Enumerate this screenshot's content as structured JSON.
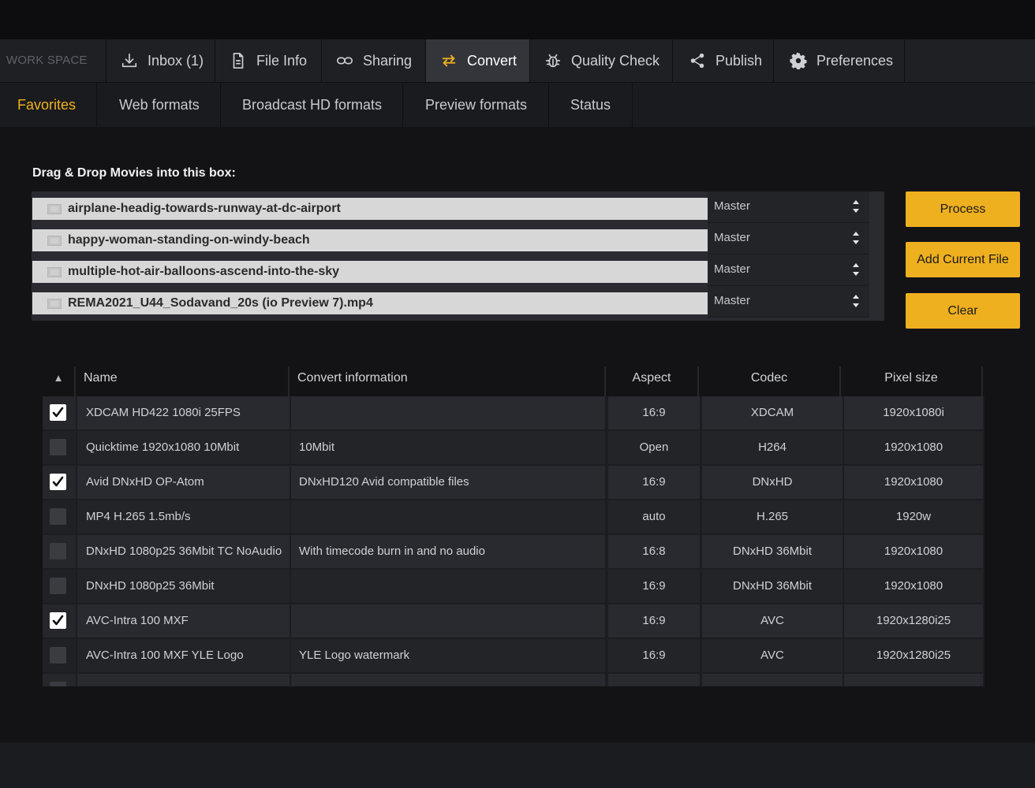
{
  "workspace_label": "WORK SPACE",
  "nav": [
    {
      "label": "Inbox (1)",
      "icon": "download-icon",
      "active": false
    },
    {
      "label": "File Info",
      "icon": "document-icon",
      "active": false
    },
    {
      "label": "Sharing",
      "icon": "link-icon",
      "active": false
    },
    {
      "label": "Convert",
      "icon": "convert-arrows-icon",
      "active": true
    },
    {
      "label": "Quality Check",
      "icon": "bug-icon",
      "active": false
    },
    {
      "label": "Publish",
      "icon": "share-icon",
      "active": false
    },
    {
      "label": "Preferences",
      "icon": "gear-icon",
      "active": false
    }
  ],
  "subnav": [
    {
      "label": "Favorites",
      "active": true
    },
    {
      "label": "Web formats",
      "active": false
    },
    {
      "label": "Broadcast HD formats",
      "active": false
    },
    {
      "label": "Preview formats",
      "active": false
    },
    {
      "label": "Status",
      "active": false
    }
  ],
  "drop_label": "Drag & Drop Movies into this box:",
  "files": [
    {
      "name": "airplane-headig-towards-runway-at-dc-airport",
      "version": "Master"
    },
    {
      "name": "happy-woman-standing-on-windy-beach",
      "version": "Master"
    },
    {
      "name": "multiple-hot-air-balloons-ascend-into-the-sky",
      "version": "Master"
    },
    {
      "name": "REMA2021_U44_Sodavand_20s (io Preview 7).mp4",
      "version": "Master"
    }
  ],
  "buttons": {
    "process": "Process",
    "add_current_file": "Add Current File",
    "clear": "Clear"
  },
  "table": {
    "sort_indicator": "▲",
    "headers": {
      "name": "Name",
      "convert_info": "Convert information",
      "aspect": "Aspect",
      "codec": "Codec",
      "pixel_size": "Pixel size"
    },
    "rows": [
      {
        "checked": true,
        "name": "XDCAM HD422 1080i 25FPS",
        "info": "",
        "aspect": "16:9",
        "codec": "XDCAM",
        "pixel": "1920x1080i"
      },
      {
        "checked": false,
        "name": "Quicktime 1920x1080 10Mbit",
        "info": "10Mbit",
        "aspect": "Open",
        "codec": "H264",
        "pixel": "1920x1080"
      },
      {
        "checked": true,
        "name": "Avid DNxHD OP-Atom",
        "info": "DNxHD120 Avid compatible files",
        "aspect": "16:9",
        "codec": "DNxHD",
        "pixel": "1920x1080"
      },
      {
        "checked": false,
        "name": "MP4 H.265 1.5mb/s",
        "info": "",
        "aspect": "auto",
        "codec": "H.265",
        "pixel": "1920w"
      },
      {
        "checked": false,
        "name": "DNxHD 1080p25 36Mbit TC NoAudio",
        "info": "With timecode burn in and no audio",
        "aspect": "16:8",
        "codec": "DNxHD 36Mbit",
        "pixel": "1920x1080"
      },
      {
        "checked": false,
        "name": "DNxHD 1080p25 36Mbit",
        "info": "",
        "aspect": "16:9",
        "codec": "DNxHD 36Mbit",
        "pixel": "1920x1080"
      },
      {
        "checked": true,
        "name": "AVC-Intra 100 MXF",
        "info": "",
        "aspect": "16:9",
        "codec": "AVC",
        "pixel": "1920x1280i25"
      },
      {
        "checked": false,
        "name": "AVC-Intra 100 MXF YLE Logo",
        "info": "YLE Logo watermark",
        "aspect": "16:9",
        "codec": "AVC",
        "pixel": "1920x1280i25"
      },
      {
        "checked": false,
        "name": "",
        "info": "",
        "aspect": "",
        "codec": "",
        "pixel": ""
      }
    ]
  },
  "colors": {
    "accent": "#f0b21d",
    "button": "#efb020"
  }
}
